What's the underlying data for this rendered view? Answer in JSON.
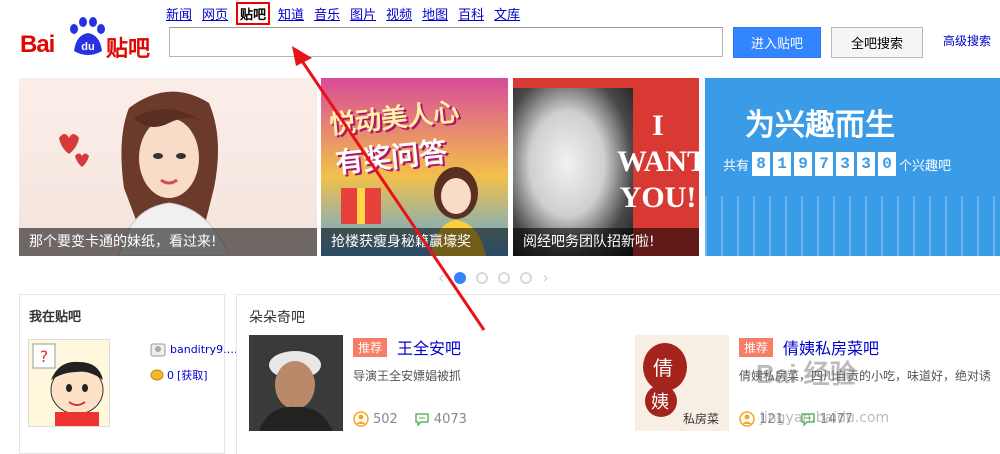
{
  "header": {
    "logo_bai": "Bai",
    "logo_du": "du",
    "logo_tieba": "贴吧",
    "nav": [
      {
        "label": "新闻",
        "active": false
      },
      {
        "label": "网页",
        "active": false
      },
      {
        "label": "贴吧",
        "active": true
      },
      {
        "label": "知道",
        "active": false
      },
      {
        "label": "音乐",
        "active": false
      },
      {
        "label": "图片",
        "active": false
      },
      {
        "label": "视频",
        "active": false
      },
      {
        "label": "地图",
        "active": false
      },
      {
        "label": "百科",
        "active": false
      },
      {
        "label": "文库",
        "active": false
      }
    ],
    "search_value": "",
    "enter_button": "进入贴吧",
    "search_all_button": "全吧搜索",
    "advanced_search": "高级搜索"
  },
  "banners": [
    {
      "caption": "那个要变卡通的妹纸，看过来!"
    },
    {
      "caption": "抢楼获瘦身秘籍赢壕奖",
      "art_line1": "悦动美人心",
      "art_line2": "有奖问答"
    },
    {
      "caption": "阅经吧务团队招新啦!",
      "art_text": "I WANT YOU!"
    },
    {
      "title": "为兴趣而生",
      "count_prefix": "共有",
      "digits": [
        "8",
        "1",
        "9",
        "7",
        "3",
        "3",
        "0"
      ],
      "count_suffix": "个兴趣吧"
    }
  ],
  "carousel": {
    "dots": 4,
    "active_index": 0
  },
  "my_tieba": {
    "title": "我在贴吧",
    "username": "banditry9.…",
    "coins_value": "0",
    "claim_label": "[获取]"
  },
  "featured": {
    "title": "朵朵奇吧",
    "cards": [
      {
        "tag": "推荐",
        "name": "王全安吧",
        "desc": "导演王全安嫖娼被抓",
        "members": "502",
        "posts": "4073"
      },
      {
        "tag": "推荐",
        "name": "倩姨私房菜吧",
        "desc": "倩姨私房菜，四川自贡的小吃，味道好，绝对诱",
        "thumb_text_1": "倩",
        "thumb_text_2": "姨",
        "thumb_text_3": "私房菜",
        "members": "121",
        "posts": "1477"
      }
    ]
  },
  "watermark": {
    "line1": "Bai 经验",
    "line2": "jingyan.baidu.com"
  },
  "colors": {
    "brand_red": "#e10601",
    "link_blue": "#0000cc",
    "button_blue": "#3385ff",
    "tag_orange": "#f77d66"
  }
}
